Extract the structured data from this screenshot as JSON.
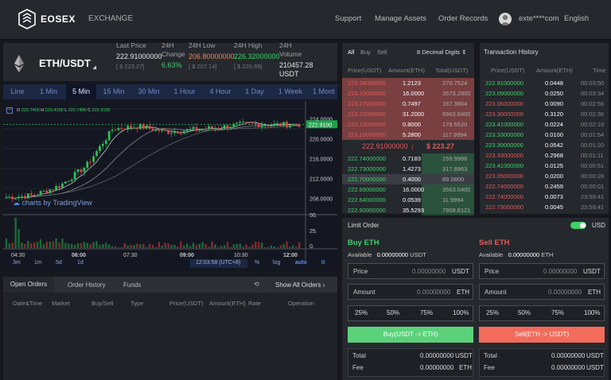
{
  "header": {
    "brand": "EOSEX",
    "exchange": "EXCHANGE",
    "nav": [
      "Support",
      "Manage Assets",
      "Order Records"
    ],
    "user": "exte****com",
    "language": "English"
  },
  "ticker": {
    "pair": "ETH/USDT",
    "last_price_label": "Last Price",
    "last_price": "222.91000000",
    "last_price_sub": "[ $ 223.27]",
    "change_label": "24H Change",
    "change": "6.63%",
    "low_label": "24H Low",
    "low": "206.80000000",
    "low_sub": "[ $ 207.14]",
    "high_label": "24H High",
    "high": "226.32000000",
    "high_sub": "[ $ 226.69]",
    "volume_label": "24H Volume",
    "volume": "210457.28 USDT"
  },
  "timeframes": [
    "Line",
    "1 Min",
    "5 Min",
    "15 Min",
    "30 Min",
    "1 Hour",
    "4 Hour",
    "1 Day",
    "1 Week",
    "1 Mont"
  ],
  "selected_timeframe": "5 Min",
  "chart": {
    "ohlc": {
      "o": "222.7400",
      "h": "223.4100",
      "l": "222.7400",
      "c": "222.9100"
    },
    "price_labels": [
      "224.0000",
      "222.9100",
      "220.0000",
      "216.0000",
      "212.0000",
      "208.0000"
    ],
    "current_price_tag": "222.9100",
    "vol_labels": [
      "50.",
      "25.",
      "0."
    ],
    "time_labels": [
      "04:30",
      "06:00",
      "07:30",
      "09:00",
      "10:30",
      "12:00"
    ],
    "watermark": "charts by TradingView",
    "ranges": [
      "3m",
      "1m",
      "5d",
      "1d"
    ],
    "clock": "12:03:58 (UTC+8)",
    "scale_opts": [
      "%",
      "log",
      "auto"
    ]
  },
  "chart_data": {
    "type": "candlestick",
    "title": "",
    "x": [
      "04:30",
      "06:00",
      "07:30",
      "09:00",
      "10:30",
      "12:00"
    ],
    "ylim": [
      206,
      226
    ],
    "close_samples": [
      208.2,
      208.6,
      210.5,
      214.5,
      222.0,
      222.5,
      221.4,
      221.8,
      222.3,
      223.0,
      222.8,
      222.91
    ]
  },
  "orderbook": {
    "tabs": [
      "All",
      "Buy",
      "Sell"
    ],
    "digits": "8 Decimal Digits",
    "headers": [
      "Price(USDT)",
      "Amount(ETH)",
      "Total(USDT)"
    ],
    "asks": [
      [
        "223.34000000",
        "1.2123",
        "270.7524"
      ],
      [
        "223.33000000",
        "16.0000",
        "3573.2800"
      ],
      [
        "223.27000000",
        "0.7497",
        "167.3864"
      ],
      [
        "223.20000000",
        "31.2000",
        "6963.8400"
      ],
      [
        "223.19000000",
        "0.8000",
        "178.5520"
      ],
      [
        "223.10000000",
        "5.2800",
        "117.9994"
      ]
    ],
    "mid_price": "222.91000000",
    "mid_arrow": "↓",
    "mid_usd": "$ 223.27",
    "bids": [
      [
        "222.74000000",
        "0.7183",
        "159.9986"
      ],
      [
        "222.73000000",
        "1.4273",
        "317.8963"
      ],
      [
        "222.70000000",
        "0.4000",
        "89.0800"
      ],
      [
        "222.69000000",
        "16.0000",
        "3563.0400"
      ],
      [
        "222.64000000",
        "0.0539",
        "11.9994"
      ],
      [
        "222.60000000",
        "35.5293",
        "7908.8121"
      ]
    ]
  },
  "transactions": {
    "title": "Transaction History",
    "headers": [
      "Price(USDT)",
      "Amount(ETH)",
      "Time"
    ],
    "rows": [
      [
        "222.91000000",
        "0.0448",
        "00:03:50",
        "g"
      ],
      [
        "223.09000000",
        "0.0250",
        "00:03:34",
        "g"
      ],
      [
        "223.06000000",
        "0.0090",
        "00:02:56",
        "r"
      ],
      [
        "223.30000000",
        "0.3120",
        "00:02:36",
        "r"
      ],
      [
        "223.41000000",
        "0.0224",
        "00:02:19",
        "g"
      ],
      [
        "223.33000000",
        "0.0100",
        "00:01:54",
        "g"
      ],
      [
        "223.30000000",
        "0.0542",
        "00:01:20",
        "g"
      ],
      [
        "223.33000000",
        "0.2968",
        "00:01:11",
        "r"
      ],
      [
        "223.41000000",
        "0.0125",
        "00:00:51",
        "g"
      ],
      [
        "223.05000000",
        "0.0200",
        "00:00:28",
        "r"
      ],
      [
        "222.74000000",
        "0.2459",
        "00:00:01",
        "r"
      ],
      [
        "222.74000000",
        "0.0073",
        "23:59:41",
        "r"
      ],
      [
        "222.73000000",
        "0.0045",
        "23:59:41",
        "r"
      ]
    ]
  },
  "limit": {
    "title": "Limit Order",
    "currency": "USD",
    "buy": {
      "title": "Buy ETH",
      "available_label": "Available",
      "available": "0.00000000",
      "available_unit": "USDT",
      "price_label": "Price",
      "price": "0.00000000",
      "price_unit": "USDT",
      "amount_label": "Amount",
      "amount": "0.00000000",
      "amount_unit": "ETH",
      "button": "Buy(USDT -> ETH)",
      "total_label": "Total",
      "total": "0.00000000",
      "total_unit": "USDT",
      "fee_label": "Fee",
      "fee": "0.00000000",
      "fee_unit": "ETH"
    },
    "sell": {
      "title": "Sell ETH",
      "available_label": "Available",
      "available": "0.00000000",
      "available_unit": "ETH",
      "price_label": "Price",
      "price": "0.00000000",
      "price_unit": "USDT",
      "amount_label": "Amount",
      "amount": "0.00000000",
      "amount_unit": "ETH",
      "button": "Sell(ETH -> USDT)",
      "total_label": "Total",
      "total": "0.00000000",
      "total_unit": "USDT",
      "fee_label": "Fee",
      "fee": "0.00000000",
      "fee_unit": "USDT"
    },
    "percents": [
      "25%",
      "50%",
      "75%",
      "100%"
    ]
  },
  "orders": {
    "tabs": [
      "Open Orders",
      "Order History",
      "Funds"
    ],
    "show_all": "Show All Orders",
    "columns": [
      "Date&Time",
      "Market",
      "Buy/Sell",
      "Type",
      "Price(USDT)",
      "Amount(ETH)",
      "Rate",
      "Operation"
    ]
  },
  "colors": {
    "green": "#3fd16a",
    "red": "#e35a5a",
    "buy_button": "#5bd17a",
    "sell_button": "#f26b5b",
    "bg": "#16181d",
    "panel": "#25282d"
  }
}
